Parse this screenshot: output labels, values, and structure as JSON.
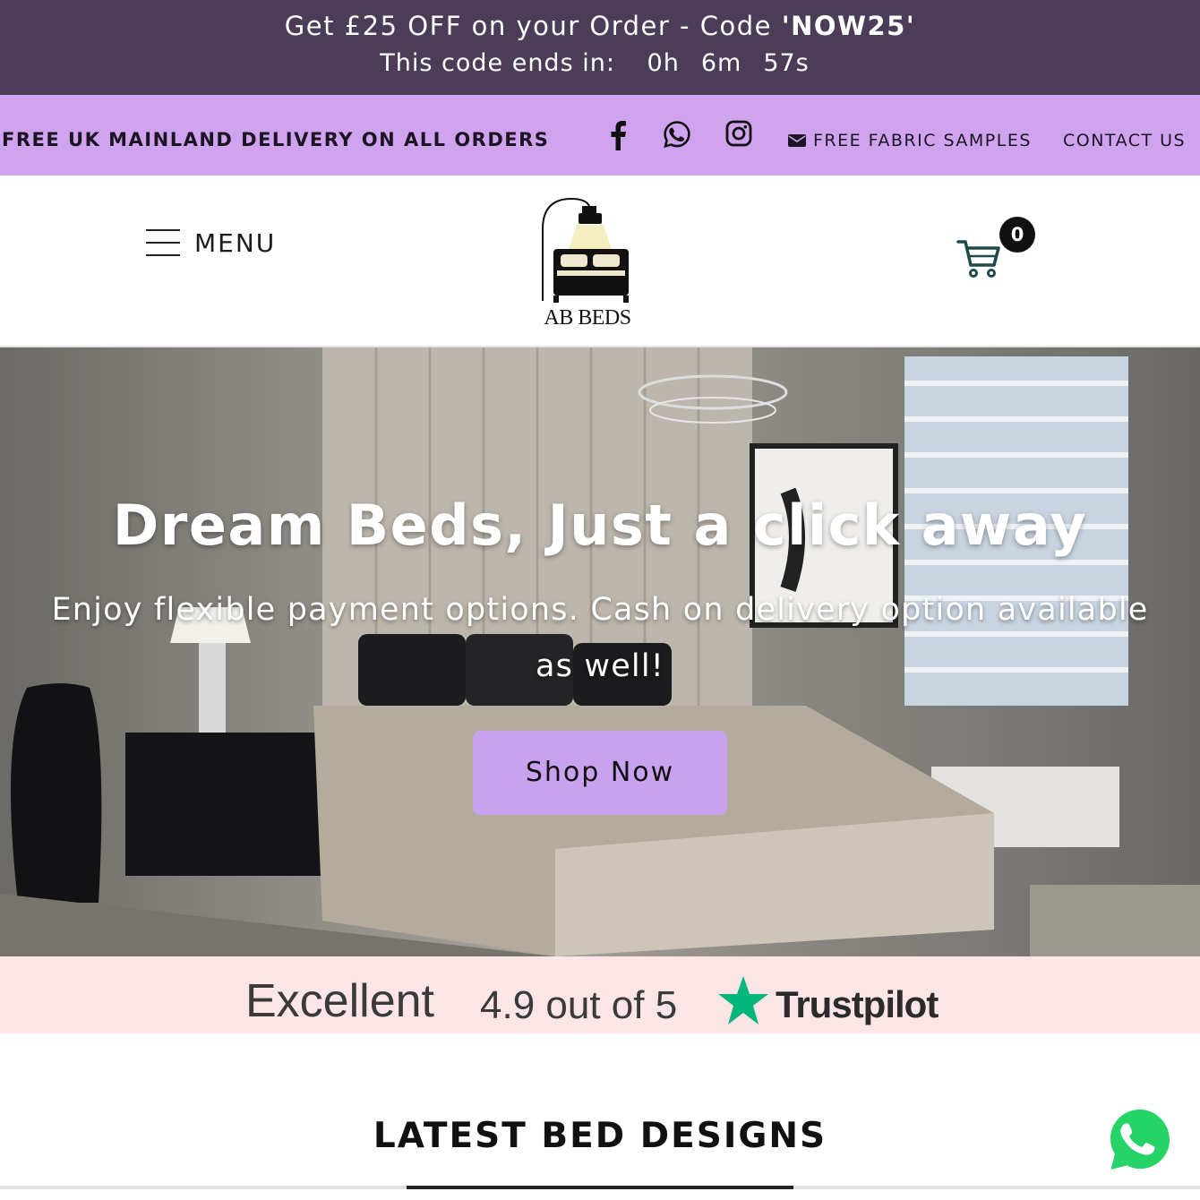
{
  "promo": {
    "prefix": "Get £25 OFF on your Order - Code ",
    "code": "'NOW25'",
    "ends_label": "This code ends in:",
    "countdown": {
      "hours": "0h",
      "minutes": "6m",
      "seconds": "57s"
    }
  },
  "infobar": {
    "delivery": "FREE UK MAINLAND DELIVERY ON ALL ORDERS",
    "social_icons": [
      "facebook-icon",
      "whatsapp-icon",
      "instagram-icon"
    ],
    "samples": "FREE FABRIC SAMPLES",
    "contact": "CONTACT US"
  },
  "header": {
    "menu_label": "MENU",
    "logo_text": "AB BEDS",
    "cart_count": "0"
  },
  "hero": {
    "title": "Dream Beds, Just a click away",
    "subtitle": "Enjoy flexible payment options. Cash on delivery option available as well!",
    "cta": "Shop Now"
  },
  "trust": {
    "rating_word": "Excellent",
    "score": "4.9 out of 5",
    "brand": "Trustpilot"
  },
  "latest": {
    "heading": "LATEST BED DESIGNS"
  },
  "colors": {
    "promo_bg": "#4b3c57",
    "infobar_bg": "#d0a3ee",
    "cta_bg": "#c9a2ef",
    "trust_bg": "#fbe5e6",
    "trustpilot_green": "#00b67a",
    "whatsapp_green": "#25d366"
  }
}
